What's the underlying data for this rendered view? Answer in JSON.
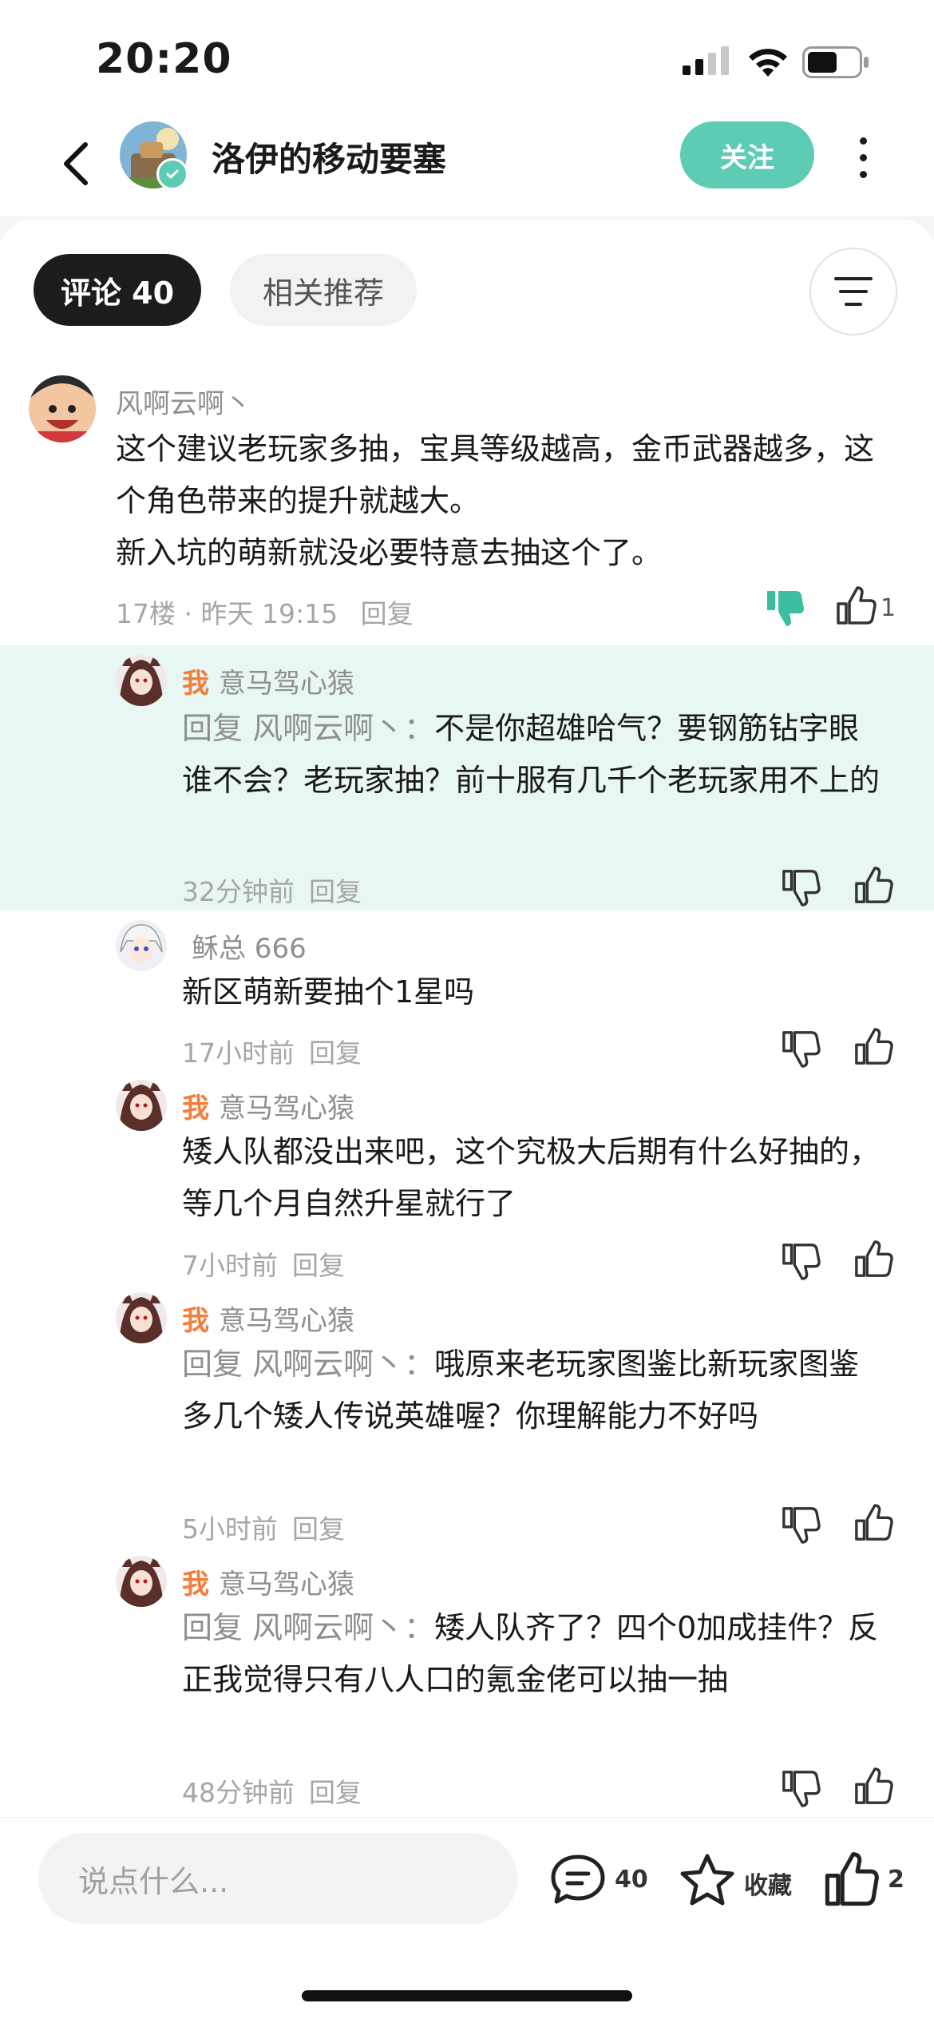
{
  "status_bar": {
    "time": "20:20"
  },
  "nav": {
    "title": "洛伊的移动要塞",
    "follow_label": "关注"
  },
  "tabs": {
    "comments": "评论 40",
    "related": "相关推荐"
  },
  "comments": [
    {
      "author": "风啊云啊丶",
      "text": "这个建议老玩家多抽，宝具等级越高，金币武器越多，这个角色带来的提升就越大。\n新入坑的萌新就没必要特意去抽这个了。",
      "floor": "17楼",
      "time": "昨天 19:15",
      "reply_label": "回复",
      "like_count": "1"
    }
  ],
  "replies": [
    {
      "me_tag": "我",
      "author": "意马驾心猿",
      "reply_prefix": "回复 风啊云啊丶：",
      "text": "不是你超雄哈气？要钢筋钻字眼谁不会？老玩家抽？前十服有几千个老玩家用不上的",
      "time": "32分钟前",
      "reply_label": "回复"
    },
    {
      "me_tag": "",
      "author": "稣总 666",
      "reply_prefix": "",
      "text": "新区萌新要抽个1星吗",
      "time": "17小时前",
      "reply_label": "回复"
    },
    {
      "me_tag": "我",
      "author": "意马驾心猿",
      "reply_prefix": "",
      "text": "矮人队都没出来吧，这个究极大后期有什么好抽的，等几个月自然升星就行了",
      "time": "7小时前",
      "reply_label": "回复"
    },
    {
      "me_tag": "我",
      "author": "意马驾心猿",
      "reply_prefix": "回复 风啊云啊丶：",
      "text": "哦原来老玩家图鉴比新玩家图鉴多几个矮人传说英雄喔？你理解能力不好吗",
      "time": "5小时前",
      "reply_label": "回复"
    },
    {
      "me_tag": "我",
      "author": "意马驾心猿",
      "reply_prefix": "回复 风啊云啊丶：",
      "text": "矮人队齐了？四个0加成挂件？反正我觉得只有八人口的氪金佬可以抽一抽",
      "time": "48分钟前",
      "reply_label": "回复"
    }
  ],
  "bottom_bar": {
    "input_placeholder": "说点什么...",
    "comment_count": "40",
    "favorite_label": "收藏",
    "like_count": "2"
  },
  "colors": {
    "accent": "#5ecbb4",
    "me_tag": "#f47d3a",
    "highlight": "#e8f7f3"
  }
}
